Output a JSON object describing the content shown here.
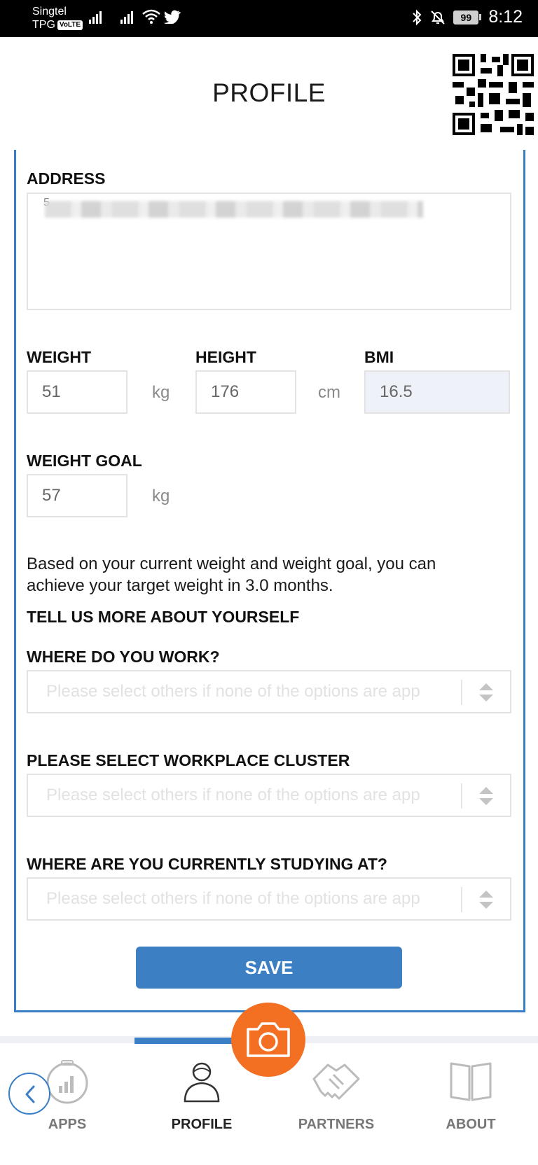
{
  "status_bar": {
    "carrier_line1": "Singtel",
    "carrier_line2": "TPG",
    "volte": "VoLTE",
    "battery": "99",
    "time": "8:12"
  },
  "header": {
    "title": "PROFILE",
    "qr_icon": "qr-code-icon"
  },
  "form": {
    "address": {
      "label": "ADDRESS",
      "value_partial": "5"
    },
    "weight": {
      "label": "WEIGHT",
      "value": "51",
      "unit": "kg"
    },
    "height": {
      "label": "HEIGHT",
      "value": "176",
      "unit": "cm"
    },
    "bmi": {
      "label": "BMI",
      "value": "16.5"
    },
    "weight_goal": {
      "label": "WEIGHT GOAL",
      "value": "57",
      "unit": "kg"
    },
    "info_text": "Based on your current weight and weight goal, you can achieve your target weight in 3.0 months.",
    "section_title": "TELL US MORE ABOUT YOURSELF",
    "work": {
      "label": "WHERE DO YOU WORK?",
      "placeholder": "Please select others if none of the options are app"
    },
    "cluster": {
      "label": "PLEASE SELECT WORKPLACE CLUSTER",
      "placeholder": "Please select others if none of the options are app"
    },
    "study": {
      "label": "WHERE ARE YOU CURRENTLY STUDYING AT?",
      "placeholder": "Please select others if none of the options are app"
    },
    "save_label": "SAVE"
  },
  "bottom_nav": {
    "items": [
      {
        "label": "APPS",
        "icon": "apps-chart-icon"
      },
      {
        "label": "PROFILE",
        "icon": "profile-person-icon"
      },
      {
        "label": "PARTNERS",
        "icon": "handshake-icon"
      },
      {
        "label": "ABOUT",
        "icon": "book-icon"
      }
    ],
    "active": "PROFILE",
    "fab_icon": "camera-icon",
    "back_icon": "chevron-left-icon"
  },
  "colors": {
    "accent": "#3a7ec6",
    "fab": "#f36f21",
    "status_bar": "#000000"
  }
}
